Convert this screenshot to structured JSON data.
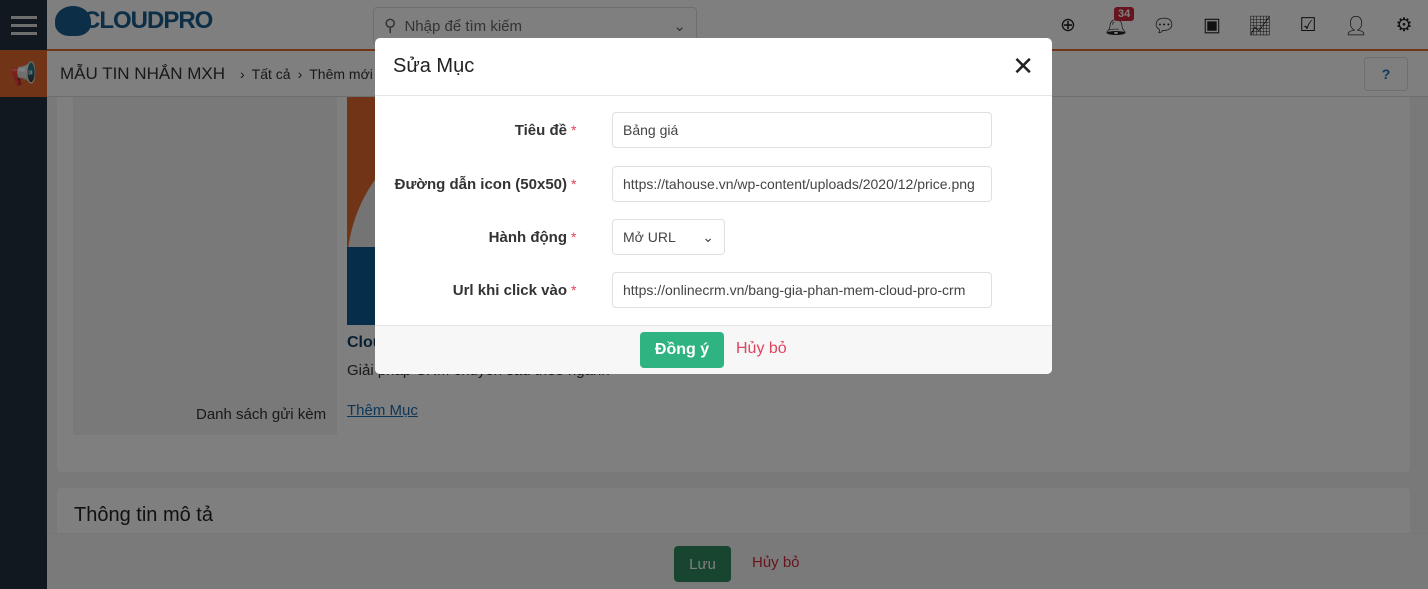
{
  "header": {
    "logo_text": "CLOUDPRO",
    "search_placeholder": "Nhập để tìm kiếm",
    "notification_count": "34",
    "icons": [
      "plus-circle-icon",
      "bell-icon",
      "chat-icon",
      "calendar-icon",
      "chart-icon",
      "checkbox-icon",
      "user-icon",
      "gear-icon"
    ]
  },
  "breadcrumb": {
    "module": "MẪU TIN NHẮN MXH",
    "items": [
      "Tất cả",
      "Thêm mới"
    ]
  },
  "form": {
    "attach_label": "Danh sách gửi kèm",
    "card_title": "Cloud",
    "card_desc": "Giải pháp CRM chuyên sâu theo ngành",
    "add_item": "Thêm Mục",
    "section2": "Thông tin mô tả",
    "save": "Lưu",
    "cancel": "Hủy bỏ"
  },
  "modal": {
    "title": "Sửa Mục",
    "fields": [
      {
        "label": "Tiêu đề",
        "value": "Bảng giá"
      },
      {
        "label": "Đường dẫn icon (50x50)",
        "value": "https://tahouse.vn/wp-content/uploads/2020/12/price.png"
      },
      {
        "label": "Hành động",
        "value": "Mở URL"
      },
      {
        "label": "Url khi click vào",
        "value": "https://onlinecrm.vn/bang-gia-phan-mem-cloud-pro-crm"
      }
    ],
    "required_mark": "*",
    "ok": "Đồng ý",
    "cancel": "Hủy bỏ"
  },
  "colors": {
    "accent": "#e4692e",
    "primary": "#2fb380",
    "danger": "#e0435d"
  }
}
